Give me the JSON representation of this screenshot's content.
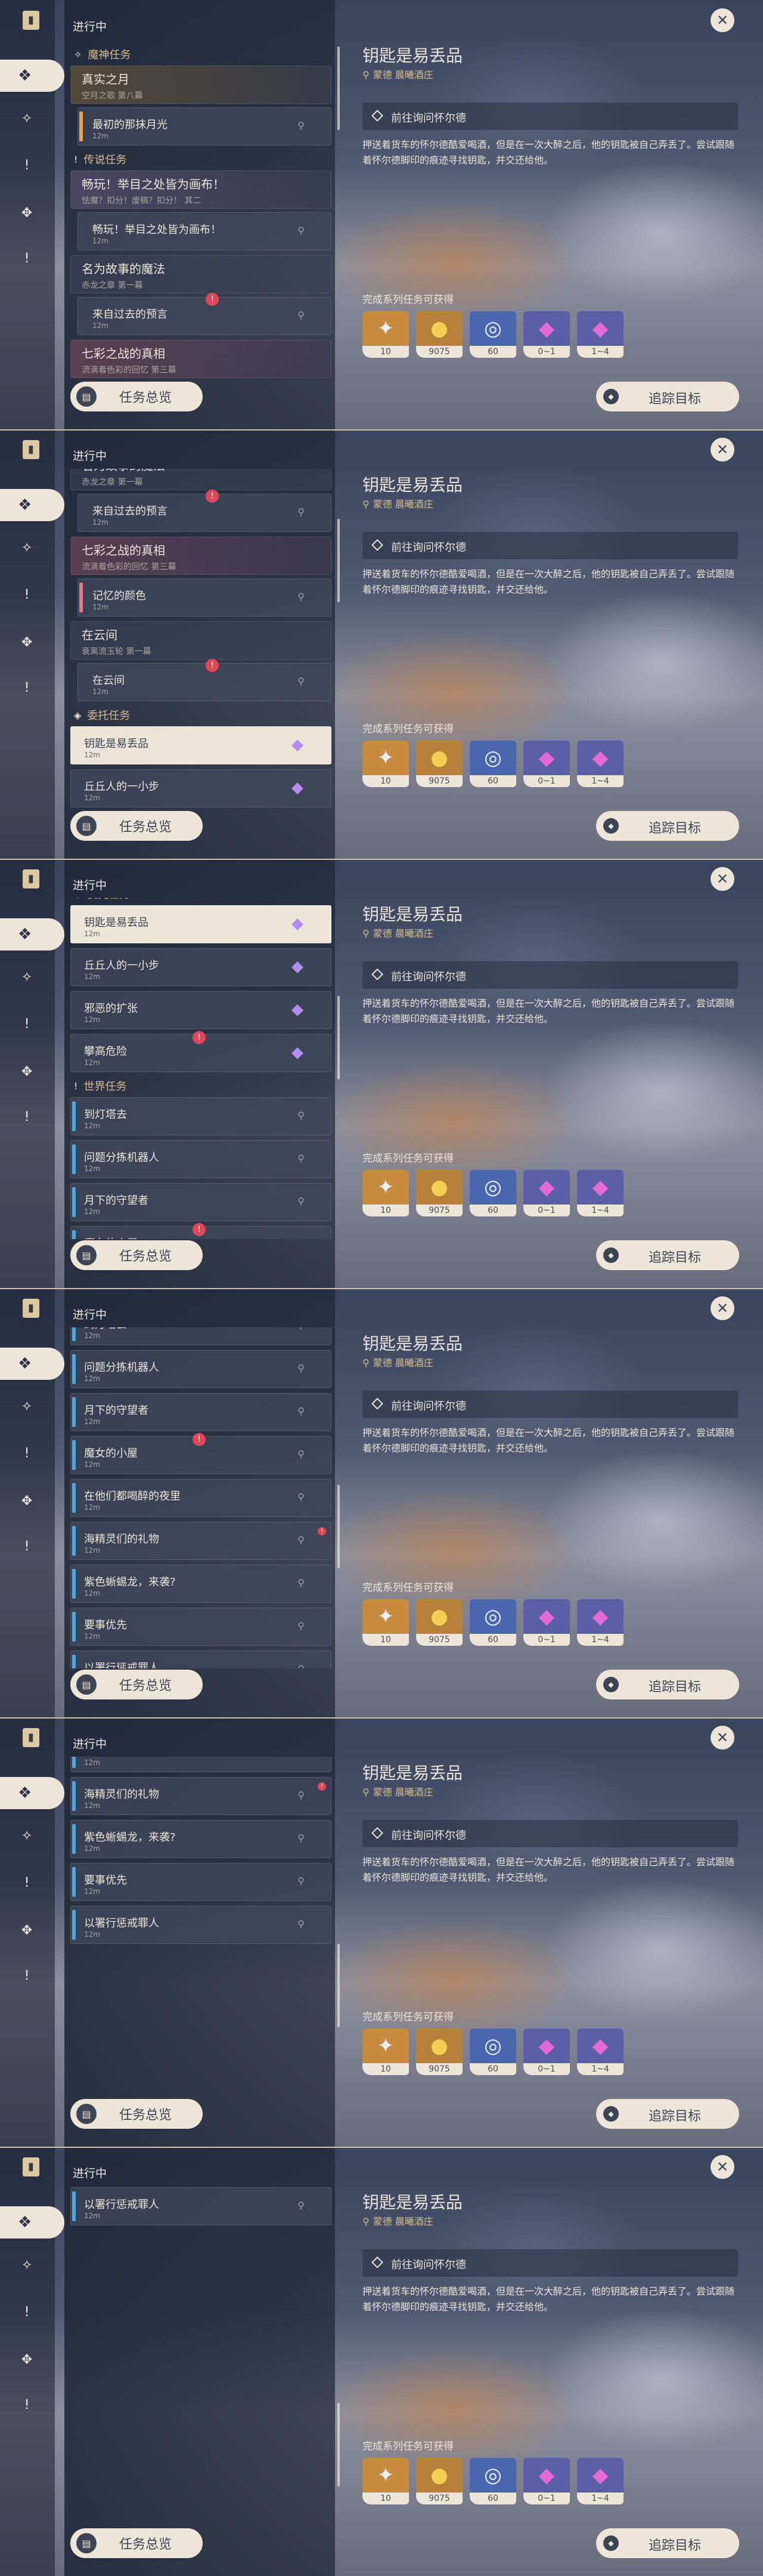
{
  "header": {
    "status": "进行中"
  },
  "buttons": {
    "overview": "任务总览",
    "track": "追踪目标"
  },
  "icons": {
    "rail": [
      "book-icon",
      "quest-diamond-icon",
      "archon-icon",
      "exclamation-icon",
      "world-icon",
      "exclamation-icon"
    ],
    "close": "close-icon"
  },
  "detail": {
    "title": "钥匙是易丢品",
    "location": "蒙德  晨曦酒庄",
    "objective": "前往询问怀尔德",
    "description": "押送着货车的怀尔德酷爱喝酒，但是在一次大醉之后，他的钥匙被自己弄丢了。尝试跟随着怀尔德脚印的痕迹寻找钥匙，并交还给他。",
    "rewards_label": "完成系列任务可获得",
    "rewards": [
      {
        "name": "adventure-exp",
        "qty": "10",
        "color": "#c88a3e",
        "glyph": "✦"
      },
      {
        "name": "mora",
        "qty": "9075",
        "color": "#b7813c",
        "glyph": "●"
      },
      {
        "name": "companionship-exp",
        "qty": "60",
        "color": "#4a66b0",
        "glyph": "◎"
      },
      {
        "name": "crystal-small",
        "qty": "0~1",
        "color": "#5b5fa8",
        "glyph": "◆"
      },
      {
        "name": "crystal-large",
        "qty": "1~4",
        "color": "#5b5fa8",
        "glyph": "◆"
      }
    ]
  },
  "quests": {
    "archon": {
      "header": "魔神任务",
      "title": "真实之月",
      "subtitle": "空月之歌 第八幕",
      "steps": [
        {
          "label": "最初的那抹月光",
          "dist": "12m"
        }
      ]
    },
    "legend": {
      "header": "传说任务",
      "title": "畅玩！举目之处皆为画布！",
      "subtitle": "怯魔？扣分！废稿？扣分！ 其二",
      "steps": [
        {
          "label": "畅玩！举目之处皆为画布！",
          "dist": "12m"
        }
      ]
    },
    "magic": {
      "title": "名为故事的魔法",
      "subtitle": "赤龙之章 第一幕",
      "steps": [
        {
          "label": "来自过去的预言",
          "dist": "12m"
        }
      ]
    },
    "rainbow": {
      "title": "七彩之战的真相",
      "subtitle": "流滴着色彩的回忆 第三幕",
      "steps": [
        {
          "label": "记忆的颜色",
          "dist": "12m"
        }
      ]
    },
    "cloud": {
      "title": "在云间",
      "subtitle": "衰离流玉轮 第一幕",
      "steps": [
        {
          "label": "在云间",
          "dist": "12m"
        }
      ]
    },
    "commission": {
      "header": "委托任务",
      "items": [
        {
          "label": "钥匙是易丢品",
          "dist": "12m"
        },
        {
          "label": "丘丘人的一小步",
          "dist": "12m"
        },
        {
          "label": "邪恶的扩张",
          "dist": "12m"
        },
        {
          "label": "攀高危险",
          "dist": "12m"
        }
      ]
    },
    "world": {
      "header": "世界任务",
      "items": [
        {
          "label": "到灯塔去",
          "dist": "12m"
        },
        {
          "label": "问题分拣机器人",
          "dist": "12m"
        },
        {
          "label": "月下的守望者",
          "dist": "12m"
        },
        {
          "label": "魔女的小屋",
          "dist": "12m"
        },
        {
          "label": "在他们都喝醉的夜里",
          "dist": "12m"
        },
        {
          "label": "海精灵们的礼物",
          "dist": "12m"
        },
        {
          "label": "紫色蜥蜴龙，来袭?",
          "dist": "12m"
        },
        {
          "label": "要事优先",
          "dist": "12m"
        },
        {
          "label": "以署行惩戒罪人",
          "dist": "12m"
        }
      ]
    }
  }
}
